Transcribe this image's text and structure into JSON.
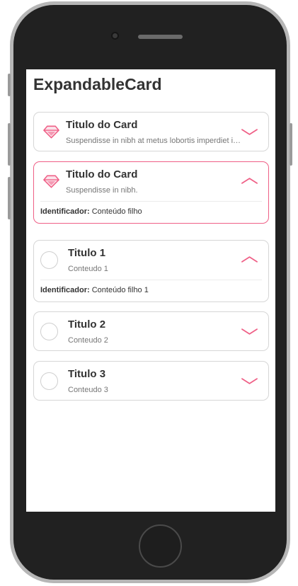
{
  "page": {
    "title": "ExpandableCard"
  },
  "colors": {
    "accent": "#ef5f86",
    "text": "#333333",
    "muted": "#777777",
    "border": "#d6d6d6"
  },
  "cards": [
    {
      "icon": "diamond-icon",
      "title": "Titulo do Card",
      "subtitle": "Suspendisse in nibh at metus lobortis imperdiet id non lorem",
      "expanded": false
    },
    {
      "icon": "diamond-icon",
      "title": "Titulo do Card",
      "subtitle": "Suspendisse in nibh.",
      "expanded": true,
      "active": true,
      "body": {
        "label": "Identificador:",
        "value": "Conteúdo filho"
      }
    },
    {
      "icon": "circle-icon",
      "title": "Titulo 1",
      "subtitle": "Conteudo 1",
      "expanded": true,
      "body": {
        "label": "Identificador:",
        "value": "Conteúdo filho 1"
      }
    },
    {
      "icon": "circle-icon",
      "title": "Titulo 2",
      "subtitle": "Conteudo 2",
      "expanded": false
    },
    {
      "icon": "circle-icon",
      "title": "Titulo 3",
      "subtitle": "Conteudo 3",
      "expanded": false
    }
  ]
}
